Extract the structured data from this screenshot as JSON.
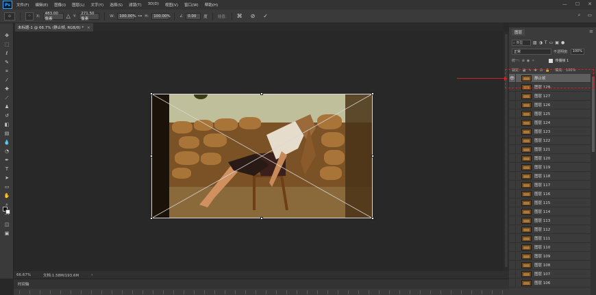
{
  "menubar": {
    "logo": "Ps",
    "items": [
      "文件(F)",
      "编辑(E)",
      "图像(I)",
      "图层(L)",
      "文字(Y)",
      "选择(S)",
      "滤镜(T)",
      "3D(D)",
      "视图(V)",
      "窗口(W)",
      "帮助(H)"
    ]
  },
  "options": {
    "x_label": "X:",
    "x_value": "483.00 像素",
    "y_label": "Y:",
    "y_value": "271.50 像素",
    "w_label": "W:",
    "w_value": "100.00%",
    "h_label": "H:",
    "h_value": "100.00%",
    "angle_label": "∠",
    "angle_value": "0.00",
    "interp": "度",
    "warp_mode": "在自由变换和变形模式之间切换"
  },
  "document": {
    "tab_title": "未标题-1 @ 66.7% (静止帧, RGB/8) *",
    "zoom": "66.67%",
    "doc_info": "文档:1.58M/193.6M"
  },
  "timeline": {
    "title": "时间轴"
  },
  "layers_panel": {
    "tab": "图层",
    "filter_placeholder": "类型",
    "blend_mode": "正常",
    "opacity_label": "不透明度:",
    "opacity_value": "100%",
    "unify_label": "统一:",
    "propagate_label": "传播帧 1",
    "lock_label": "锁定:",
    "fill_label": "填充:",
    "fill_value": "100%",
    "layers": [
      {
        "name": "静止帧",
        "visible": true,
        "selected": true
      },
      {
        "name": "图层 128",
        "visible": false,
        "selected": false
      },
      {
        "name": "图层 127",
        "visible": false,
        "selected": false
      },
      {
        "name": "图层 126",
        "visible": false,
        "selected": false
      },
      {
        "name": "图层 125",
        "visible": false,
        "selected": false
      },
      {
        "name": "图层 124",
        "visible": false,
        "selected": false
      },
      {
        "name": "图层 123",
        "visible": false,
        "selected": false
      },
      {
        "name": "图层 122",
        "visible": false,
        "selected": false
      },
      {
        "name": "图层 121",
        "visible": false,
        "selected": false
      },
      {
        "name": "图层 120",
        "visible": false,
        "selected": false
      },
      {
        "name": "图层 119",
        "visible": false,
        "selected": false
      },
      {
        "name": "图层 118",
        "visible": false,
        "selected": false
      },
      {
        "name": "图层 117",
        "visible": false,
        "selected": false
      },
      {
        "name": "图层 116",
        "visible": false,
        "selected": false
      },
      {
        "name": "图层 115",
        "visible": false,
        "selected": false
      },
      {
        "name": "图层 114",
        "visible": false,
        "selected": false
      },
      {
        "name": "图层 113",
        "visible": false,
        "selected": false
      },
      {
        "name": "图层 112",
        "visible": false,
        "selected": false
      },
      {
        "name": "图层 111",
        "visible": false,
        "selected": false
      },
      {
        "name": "图层 110",
        "visible": false,
        "selected": false
      },
      {
        "name": "图层 109",
        "visible": false,
        "selected": false
      },
      {
        "name": "图层 108",
        "visible": false,
        "selected": false
      },
      {
        "name": "图层 107",
        "visible": false,
        "selected": false
      },
      {
        "name": "图层 106",
        "visible": false,
        "selected": false
      }
    ]
  },
  "colors": {
    "annotation_red": "#d02020",
    "ps_blue": "#31a8ff"
  }
}
